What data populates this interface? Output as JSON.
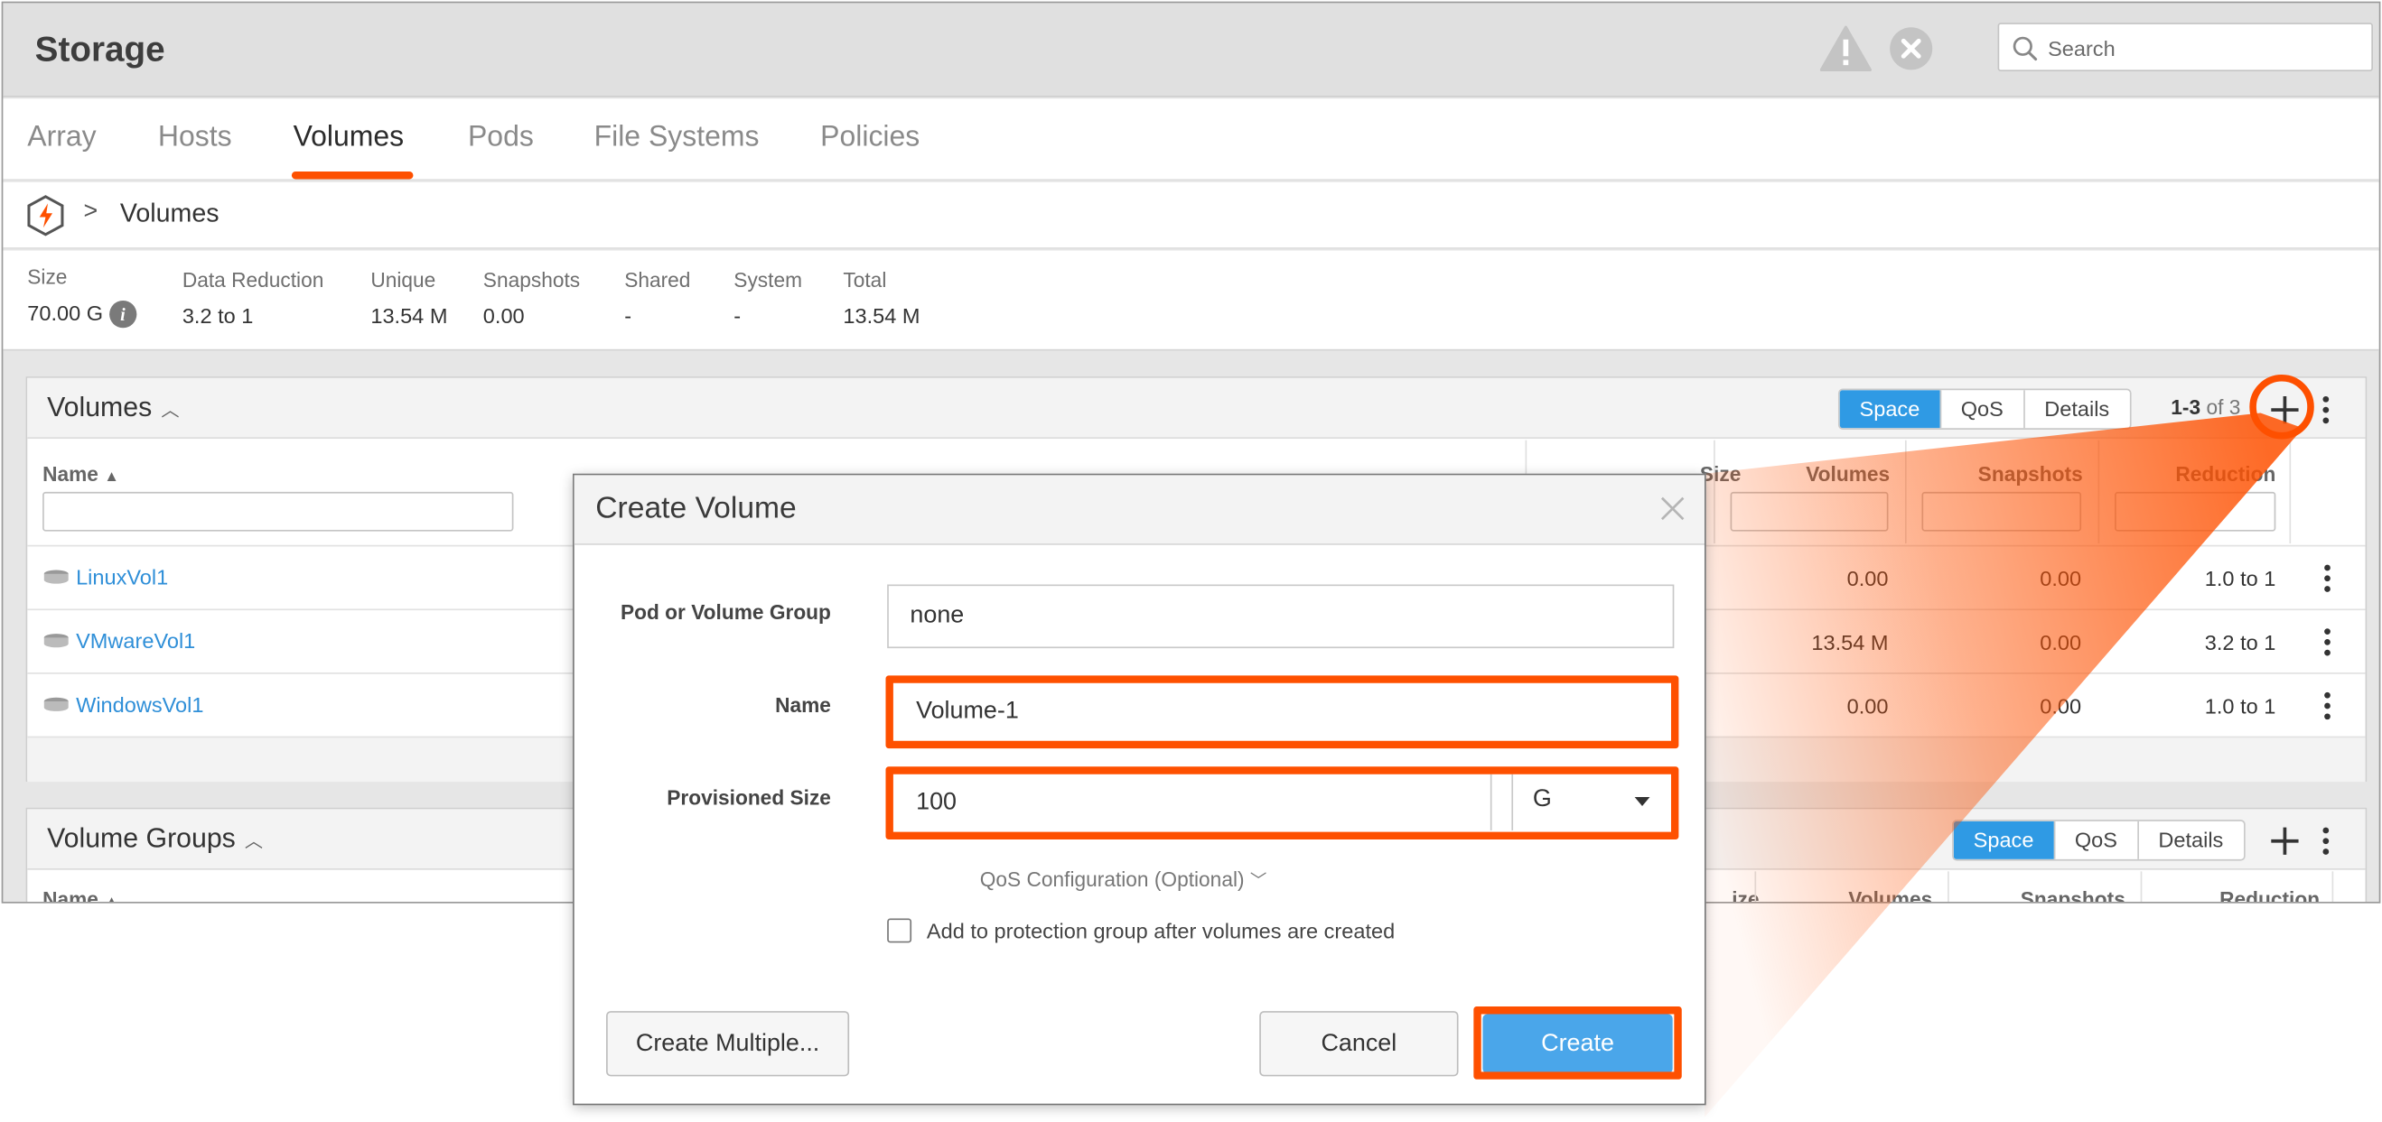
{
  "app": {
    "title": "Storage",
    "search_placeholder": "Search"
  },
  "tabs": [
    "Array",
    "Hosts",
    "Volumes",
    "Pods",
    "File Systems",
    "Policies"
  ],
  "active_tab": "Volumes",
  "breadcrumb": {
    "separator": ">",
    "current": "Volumes"
  },
  "stats": [
    {
      "label": "Size",
      "value": "70.00 G"
    },
    {
      "label": "Data Reduction",
      "value": "3.2 to 1"
    },
    {
      "label": "Unique",
      "value": "13.54 M"
    },
    {
      "label": "Snapshots",
      "value": "0.00"
    },
    {
      "label": "Shared",
      "value": "-"
    },
    {
      "label": "System",
      "value": "-"
    },
    {
      "label": "Total",
      "value": "13.54 M"
    }
  ],
  "volumes_panel": {
    "title": "Volumes",
    "views": [
      "Space",
      "QoS",
      "Details"
    ],
    "active_view": "Space",
    "pager": {
      "range": "1-3",
      "of": "of 3"
    },
    "columns": {
      "name": "Name",
      "size": "Size",
      "volumes": "Volumes",
      "snapshots": "Snapshots",
      "reduction": "Reduction"
    },
    "rows": [
      {
        "name": "LinuxVol1",
        "volumes": "0.00",
        "snapshots": "0.00",
        "reduction": "1.0 to 1"
      },
      {
        "name": "VMwareVol1",
        "volumes": "13.54 M",
        "snapshots": "0.00",
        "reduction": "3.2 to 1"
      },
      {
        "name": "WindowsVol1",
        "volumes": "0.00",
        "snapshots": "0.00",
        "reduction": "1.0 to 1"
      }
    ]
  },
  "volume_groups_panel": {
    "title": "Volume Groups",
    "views": [
      "Space",
      "QoS",
      "Details"
    ],
    "active_view": "Space",
    "columns": {
      "name": "Name",
      "size": "ize",
      "volumes": "Volumes",
      "snapshots": "Snapshots",
      "reduction": "Reduction"
    }
  },
  "dialog": {
    "title": "Create Volume",
    "pod_label": "Pod or Volume Group",
    "pod_value": "none",
    "name_label": "Name",
    "name_value": "Volume-1",
    "size_label": "Provisioned Size",
    "size_value": "100",
    "size_unit": "G",
    "qos_link": "QoS Configuration (Optional)",
    "checkbox_label": "Add to protection group after volumes are created",
    "checkbox_checked": false,
    "btn_create_multiple": "Create Multiple...",
    "btn_cancel": "Cancel",
    "btn_create": "Create"
  },
  "colors": {
    "highlight": "#fe5000",
    "accent_blue": "#2f9ae4",
    "primary_button": "#4aa6ea",
    "link": "#2f8fd8"
  }
}
